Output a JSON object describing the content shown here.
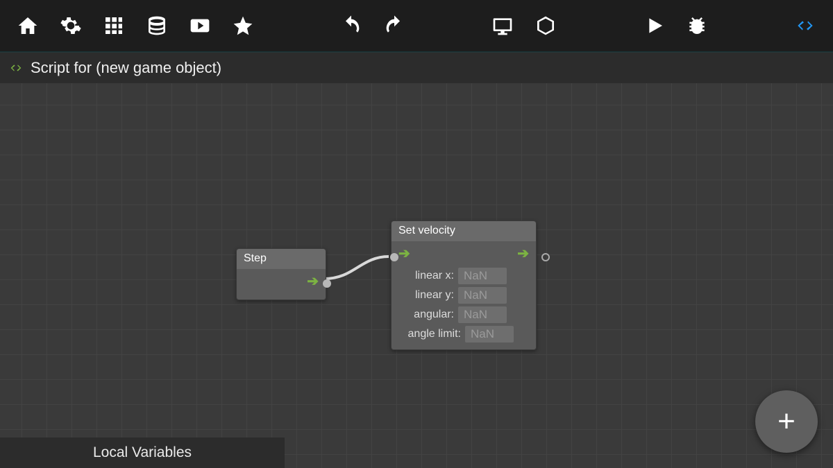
{
  "title": "Script for (new game object)",
  "toolbar": {
    "icons": [
      "home-icon",
      "gear-icon",
      "grid-icon",
      "database-icon",
      "video-icon",
      "star-icon",
      "undo-icon",
      "redo-icon",
      "monitor-icon",
      "cube-icon",
      "play-icon",
      "bug-icon",
      "code-icon"
    ]
  },
  "nodes": {
    "step": {
      "title": "Step"
    },
    "setvel": {
      "title": "Set velocity",
      "fields": [
        {
          "label": "linear x:",
          "value": "NaN"
        },
        {
          "label": "linear y:",
          "value": "NaN"
        },
        {
          "label": "angular:",
          "value": "NaN"
        },
        {
          "label": "angle limit:",
          "value": "NaN"
        }
      ]
    }
  },
  "localVariables": "Local Variables",
  "fabLabel": "+"
}
